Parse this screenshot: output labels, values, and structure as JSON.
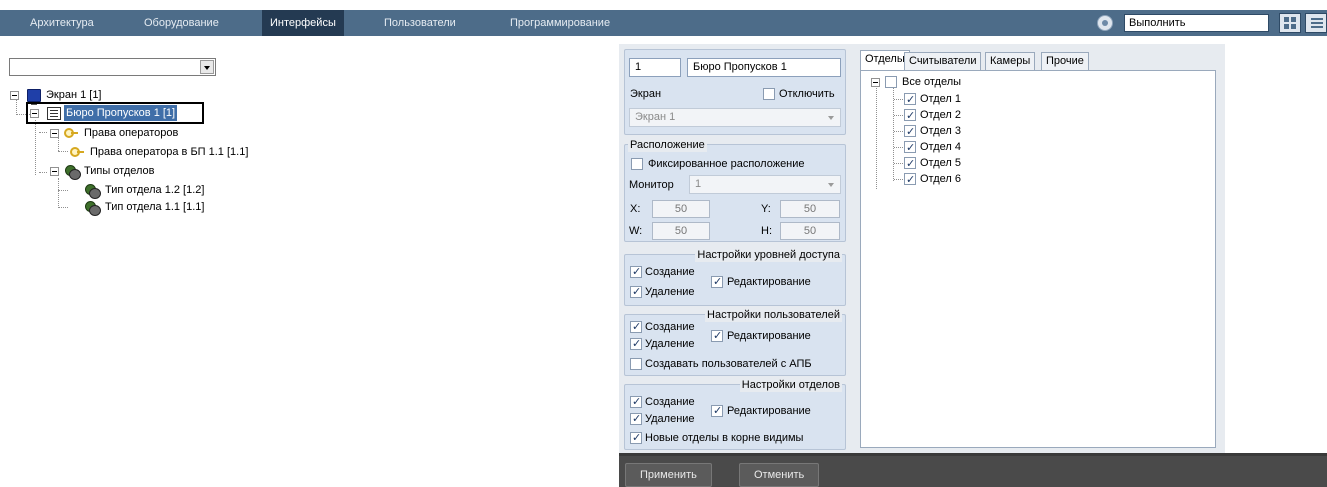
{
  "menu": {
    "items": [
      "Архитектура",
      "Оборудование",
      "Интерфейсы",
      "Пользователи",
      "Программирование"
    ],
    "active": "Интерфейсы",
    "run_value": "Выполнить",
    "colors": {
      "bar": "#4d6c89",
      "active": "#243a52"
    }
  },
  "tree": {
    "dropdown_value": "",
    "nodes": {
      "screen": "Экран 1 [1]",
      "bureau": "Бюро Пропусков 1 [1]",
      "operators": "Права операторов",
      "operator_rights": "Права оператора в БП 1.1 [1.1]",
      "dept_types": "Типы отделов",
      "dept_type_12": "Тип отдела 1.2 [1.2]",
      "dept_type_11": "Тип отдела 1.1 [1.1]"
    }
  },
  "settings": {
    "id_value": "1",
    "name_value": "Бюро Пропусков 1",
    "screen_label": "Экран",
    "disable_label": "Отключить",
    "screen_value": "Экран 1",
    "location_title": "Расположение",
    "fixed_location_label": "Фиксированное расположение",
    "monitor_label": "Монитор",
    "monitor_value": "1",
    "x_label": "X:",
    "x_value": "50",
    "y_label": "Y:",
    "y_value": "50",
    "w_label": "W:",
    "w_value": "50",
    "h_label": "H:",
    "h_value": "50",
    "access_title": "Настройки уровней доступа",
    "users_title": "Настройки пользователей",
    "depts_title": "Настройки отделов",
    "create_label": "Создание",
    "delete_label": "Удаление",
    "edit_label": "Редактирование",
    "create_users_apb_label": "Создавать пользователей с АПБ",
    "new_depts_visible_label": "Новые отделы в корне видимы"
  },
  "tabs": {
    "labels": [
      "Отделы",
      "Считыватели",
      "Камеры",
      "Прочие"
    ],
    "active": "Отделы",
    "root_label": "Все отделы",
    "departments": [
      "Отдел 1",
      "Отдел 2",
      "Отдел 3",
      "Отдел 4",
      "Отдел 5",
      "Отдел 6"
    ]
  },
  "footer": {
    "apply_label": "Применить",
    "cancel_label": "Отменить"
  }
}
